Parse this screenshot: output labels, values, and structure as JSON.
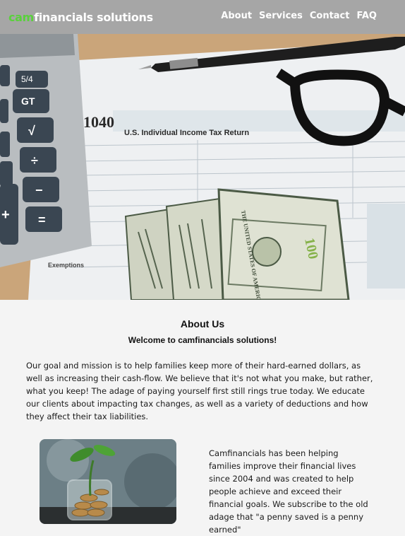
{
  "brand": {
    "accent": "cam",
    "name": "financials solutions"
  },
  "nav": {
    "items": [
      "About",
      "Services",
      "Contact",
      "FAQ"
    ]
  },
  "hero": {
    "form_number": "1040",
    "form_title": "U.S. Individual Income Tax Return",
    "calculator_keys": [
      "5/4",
      "GT",
      "√",
      "÷",
      "−",
      "+",
      "="
    ],
    "bill_value": "100",
    "bill_text": "THE UNITED STATES OF AMERICA",
    "form_label_exemptions": "Exemptions"
  },
  "about": {
    "title": "About Us",
    "subtitle": "Welcome to camfinancials solutions!",
    "intro": "Our goal and mission is to help families keep more of their hard-earned dollars, as well as increasing their cash-flow. We believe that it's not what you make, but rather, what you keep! The adage of paying yourself first still rings true today. We educate our clients about impacting tax changes, as well as a variety of deductions and how they affect their tax liabilities.",
    "history": "Camfinancials has been helping families improve their financial lives since 2004 and was created to help people achieve and exceed their financial goals. We subscribe to the old adage that \"a penny saved is a penny earned\""
  },
  "colors": {
    "navbar": "#a6a6a6",
    "brand_accent": "#5ad13c",
    "background": "#f4f4f4"
  }
}
